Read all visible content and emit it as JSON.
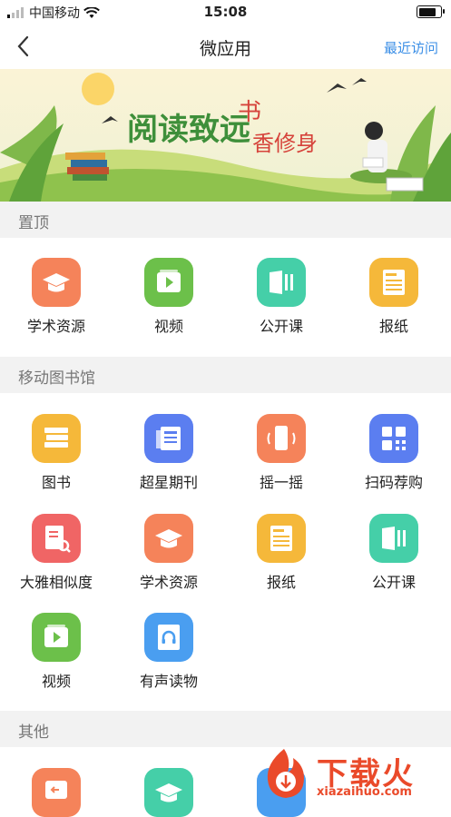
{
  "status_bar": {
    "carrier": "中国移动",
    "time": "15:08",
    "battery_level": 0.9
  },
  "nav": {
    "title": "微应用",
    "recent_label": "最近访问"
  },
  "banner": {
    "line1": "阅读致远",
    "line2_a": "书",
    "line2_b": "香修身"
  },
  "sections": [
    {
      "title": "置顶",
      "items": [
        {
          "label": "学术资源",
          "color": "#f5835a",
          "icon": "graduation-cap-icon"
        },
        {
          "label": "视频",
          "color": "#6cc04a",
          "icon": "video-play-icon"
        },
        {
          "label": "公开课",
          "color": "#45cfa8",
          "icon": "open-course-icon"
        },
        {
          "label": "报纸",
          "color": "#f5b83a",
          "icon": "newspaper-icon"
        }
      ]
    },
    {
      "title": "移动图书馆",
      "items": [
        {
          "label": "图书",
          "color": "#f5b83a",
          "icon": "books-icon"
        },
        {
          "label": "超星期刊",
          "color": "#5b7ef0",
          "icon": "journal-icon"
        },
        {
          "label": "摇一摇",
          "color": "#f5835a",
          "icon": "shake-phone-icon"
        },
        {
          "label": "扫码荐购",
          "color": "#5b7ef0",
          "icon": "qr-code-icon"
        },
        {
          "label": "大雅相似度",
          "color": "#f06565",
          "icon": "similarity-check-icon"
        },
        {
          "label": "学术资源",
          "color": "#f5835a",
          "icon": "graduation-cap-icon"
        },
        {
          "label": "报纸",
          "color": "#f5b83a",
          "icon": "newspaper-icon"
        },
        {
          "label": "公开课",
          "color": "#45cfa8",
          "icon": "open-course-icon"
        },
        {
          "label": "视频",
          "color": "#6cc04a",
          "icon": "video-play-icon"
        },
        {
          "label": "有声读物",
          "color": "#4a9ef0",
          "icon": "audiobook-icon"
        }
      ]
    },
    {
      "title": "其他",
      "items": [
        {
          "label": "",
          "color": "#f5835a",
          "icon": "exit-icon"
        },
        {
          "label": "",
          "color": "#45cfa8",
          "icon": "graduation-cap-icon"
        },
        {
          "label": "",
          "color": "#4a9ef0",
          "icon": "app-icon"
        }
      ]
    }
  ],
  "watermark": {
    "text": "下载火",
    "url": "xiazaihuo.com"
  }
}
